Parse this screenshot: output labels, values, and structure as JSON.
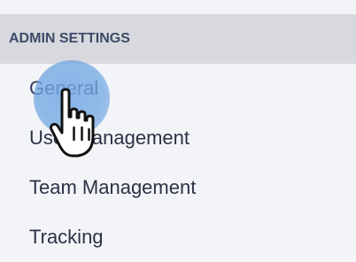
{
  "sidebar": {
    "section_title": "ADMIN SETTINGS",
    "items": [
      {
        "label": "General",
        "active": true
      },
      {
        "label": "User Management",
        "active": false
      },
      {
        "label": "Team Management",
        "active": false
      },
      {
        "label": "Tracking",
        "active": false
      }
    ]
  },
  "cursor": {
    "icon": "hand-pointer-icon",
    "halo_color": "#78aae6"
  }
}
